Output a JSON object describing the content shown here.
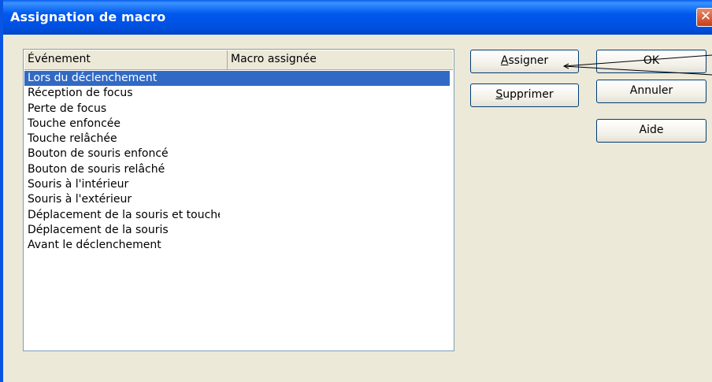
{
  "window": {
    "title": "Assignation de macro",
    "close_glyph": "✕"
  },
  "list": {
    "columns": [
      "Événement",
      "Macro assignée"
    ],
    "selected_index": 0,
    "rows": [
      "Lors du déclenchement",
      "Réception de focus",
      "Perte de focus",
      "Touche enfoncée",
      "Touche relâchée",
      "Bouton de souris enfoncé",
      "Bouton de souris relâché",
      "Souris à l'intérieur",
      "Souris à l'extérieur",
      "Déplacement de la souris et touche",
      "Déplacement de la souris",
      "Avant le déclenchement"
    ]
  },
  "buttons": {
    "assign": {
      "mnemonic": "A",
      "rest": "ssigner"
    },
    "delete": {
      "mnemonic": "S",
      "rest": "upprimer"
    },
    "ok": "OK",
    "cancel": "Annuler",
    "help": "Aide"
  },
  "colors": {
    "title_bar": "#0054E3",
    "selection": "#316AC5",
    "dialog_bg": "#ECE9D8",
    "close_button": "#D6573A"
  }
}
